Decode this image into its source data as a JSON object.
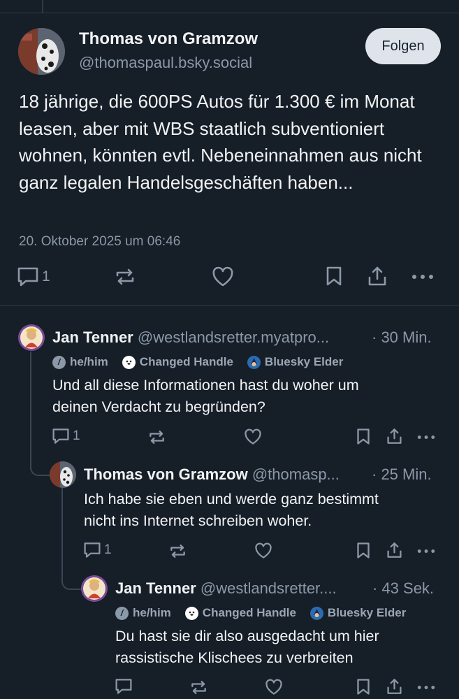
{
  "main_post": {
    "author_name": "Thomas von Gramzow",
    "author_handle": "@thomaspaul.bsky.social",
    "follow_label": "Folgen",
    "text": "18 jährige, die 600PS Autos für 1.300 € im Monat leasen, aber mit WBS staatlich subventioniert wohnen, könnten evtl. Nebeneinnahmen aus nicht ganz legalen Handelsgeschäften haben...",
    "timestamp": "20. Oktober 2025 um 06:46",
    "reply_count": "1"
  },
  "replies": [
    {
      "author_name": "Jan Tenner",
      "author_handle": "@westlandsretter.myatpro...",
      "time_ago": "· 30 Min.",
      "badges": [
        "he/him",
        "Changed Handle",
        "Bluesky Elder"
      ],
      "text_lines": [
        "Und all diese Informationen hast du woher um",
        "deinen Verdacht zu begründen?"
      ],
      "reply_count": "1"
    },
    {
      "author_name": "Thomas von Gramzow",
      "author_handle": "@thomasp...",
      "time_ago": "· 25 Min.",
      "badges": [],
      "text_lines": [
        "Ich habe sie eben und werde ganz bestimmt",
        "nicht ins Internet schreiben woher."
      ],
      "reply_count": "1"
    },
    {
      "author_name": "Jan Tenner",
      "author_handle": "@westlandsretter....",
      "time_ago": "· 43 Sek.",
      "badges": [
        "he/him",
        "Changed Handle",
        "Bluesky Elder"
      ],
      "text_lines": [
        "Du hast sie dir also ausgedacht um hier",
        "rassistische Klischees zu verbreiten"
      ],
      "reply_count": ""
    }
  ],
  "icons": {
    "reply": "speech-bubble-icon",
    "repost": "repost-arrows-icon",
    "like": "heart-icon",
    "bookmark": "bookmark-icon",
    "share": "share-icon",
    "more": "more-dots-icon"
  },
  "colors": {
    "background": "#161e27",
    "text": "#f1f3f5",
    "muted": "#8b98a8",
    "button_bg": "#dfe4ea"
  }
}
